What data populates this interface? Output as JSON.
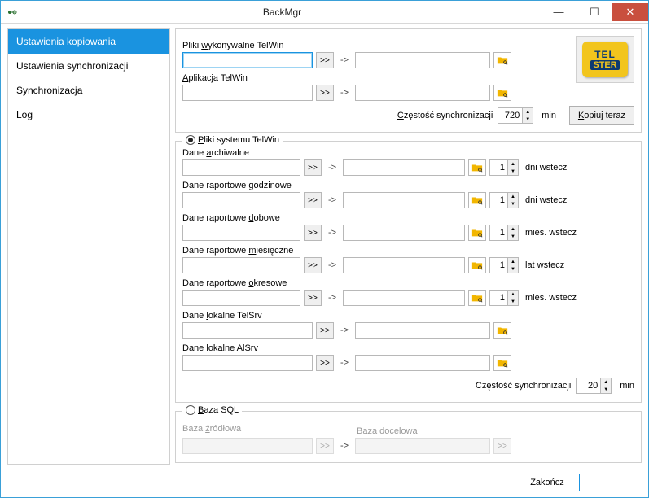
{
  "window": {
    "title": "BackMgr"
  },
  "sidebar": {
    "items": [
      {
        "label": "Ustawienia kopiowania",
        "active": true
      },
      {
        "label": "Ustawienia synchronizacji",
        "active": false
      },
      {
        "label": "Synchronizacja",
        "active": false
      },
      {
        "label": "Log",
        "active": false
      }
    ]
  },
  "top": {
    "exec_label_pre": "Pliki ",
    "exec_label_u": "w",
    "exec_label_post": "ykonywalne TelWin",
    "exec_src": "",
    "exec_dst": "",
    "app_label_pre": "",
    "app_label_u": "A",
    "app_label_post": "plikacja TelWin",
    "app_src": "",
    "app_dst": "",
    "freq_label_pre": "",
    "freq_label_u": "C",
    "freq_label_post": "zęstość synchronizacji",
    "freq_value": "720",
    "freq_unit": "min",
    "copy_label_u": "K",
    "copy_label_post": "opiuj teraz",
    "logo_top": "TEL",
    "logo_bot": "STER"
  },
  "system": {
    "title_pre": "",
    "title_u": "P",
    "title_post": "liki systemu TelWin",
    "items": [
      {
        "label_pre": "Dane ",
        "label_u": "a",
        "label_post": "rchiwalne",
        "src": "",
        "dst": "",
        "num": "1",
        "unit": "dni wstecz"
      },
      {
        "label_pre": "Dane raportowe ",
        "label_u": "g",
        "label_post": "odzinowe",
        "src": "",
        "dst": "",
        "num": "1",
        "unit": "dni wstecz"
      },
      {
        "label_pre": "Dane raportowe ",
        "label_u": "d",
        "label_post": "obowe",
        "src": "",
        "dst": "",
        "num": "1",
        "unit": "mies. wstecz"
      },
      {
        "label_pre": "Dane raportowe ",
        "label_u": "m",
        "label_post": "iesięczne",
        "src": "",
        "dst": "",
        "num": "1",
        "unit": "lat wstecz"
      },
      {
        "label_pre": "Dane raportowe ",
        "label_u": "o",
        "label_post": "kresowe",
        "src": "",
        "dst": "",
        "num": "1",
        "unit": "mies. wstecz"
      },
      {
        "label_pre": "Dane ",
        "label_u": "l",
        "label_post": "okalne TelSrv",
        "src": "",
        "dst": "",
        "num": null,
        "unit": null
      },
      {
        "label_pre": "Dane ",
        "label_u": "l",
        "label_post": "okalne AlSrv",
        "src": "",
        "dst": "",
        "num": null,
        "unit": null
      }
    ],
    "freq_label": "Częstość synchronizacji",
    "freq_value": "20",
    "freq_unit": "min"
  },
  "sql": {
    "title_pre": "",
    "title_u": "B",
    "title_post": "aza SQL",
    "src_label_pre": "Baza ",
    "src_label_u": "ź",
    "src_label_post": "ródłowa",
    "dst_label": "Baza docelowa",
    "src": "",
    "dst": ""
  },
  "footer": {
    "close_label": "Zakończ"
  },
  "symbols": {
    "dd": ">>",
    "arrow": "->"
  }
}
